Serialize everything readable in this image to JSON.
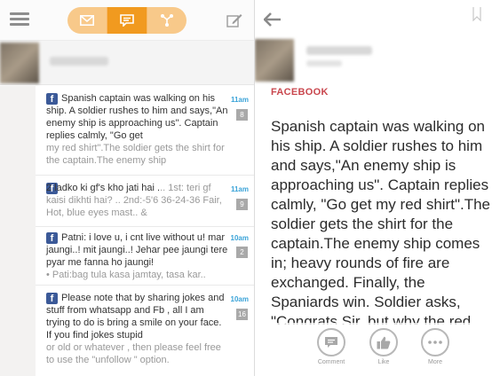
{
  "left_pane": {
    "topbar": {
      "menu_icon": "hamburger-icon",
      "tabs": [
        {
          "icon": "envelope-icon",
          "active": false
        },
        {
          "icon": "chat-bubble-icon",
          "active": true
        },
        {
          "icon": "share-network-icon",
          "active": false
        }
      ],
      "compose_icon": "compose-icon",
      "tab_active_color": "#f19a1f",
      "tab_inactive_color": "#f8c98a"
    },
    "feed": [
      {
        "source_icon": "facebook-icon",
        "text": "Spanish captain was walking on his ship. A soldier rushes to him and says,\"An enemy ship is approaching us\". Captain replies calmly, \"Go get",
        "preview": "my red shirt\".The soldier gets the shirt for the captain.The enemy ship",
        "time": "11am",
        "count": "8"
      },
      {
        "source_icon": "facebook-icon",
        "text": "2 ladko ki gf's kho jati hai .",
        "preview": ".. 1st: teri gf kaisi dikhti hai? .. 2nd:-5'6 36-24-36 Fair, Hot, blue eyes mast.. &",
        "time": "11am",
        "count": "9"
      },
      {
        "source_icon": "facebook-icon",
        "text": "Patni: i love u, i cnt live without u! mar jaungi..! mit jaungi..! Jehar pee jaungi tere pyar me fanna ho jaungi!",
        "preview": "• Pati:bag tula kasa jamtay, tasa kar..",
        "time": "10am",
        "count": "2"
      },
      {
        "source_icon": "facebook-icon",
        "text": "Please note that by sharing jokes and stuff from whatsapp and Fb , all I am trying to do is bring a smile on your face. If you find jokes stupid",
        "preview": "or old or whatever , then please feel free to use the \"unfollow \" option.",
        "time": "10am",
        "count": "16"
      }
    ]
  },
  "right_pane": {
    "back_icon": "back-arrow-icon",
    "bookmark_icon": "bookmark-icon",
    "source_label": "FACEBOOK",
    "source_color": "#c9474e",
    "body_lines": [
      "Spanish captain was walking on",
      "his ship. A soldier rushes to him",
      "and says,\"An enemy ship is",
      "approaching us\". Captain replies",
      "calmly, \"Go get my red shirt\".The",
      "soldier gets the shirt for the",
      "captain.The enemy ship comes",
      "in; heavy rounds of fire are",
      "exchanged. Finally, the",
      "Spaniards win. Soldier asks,",
      "\"Congrats Sir, but why the red"
    ],
    "actions": [
      {
        "icon": "comment-icon",
        "label": "Comment"
      },
      {
        "icon": "like-thumb-icon",
        "label": "Like"
      },
      {
        "icon": "more-dots-icon",
        "label": "More"
      }
    ]
  }
}
